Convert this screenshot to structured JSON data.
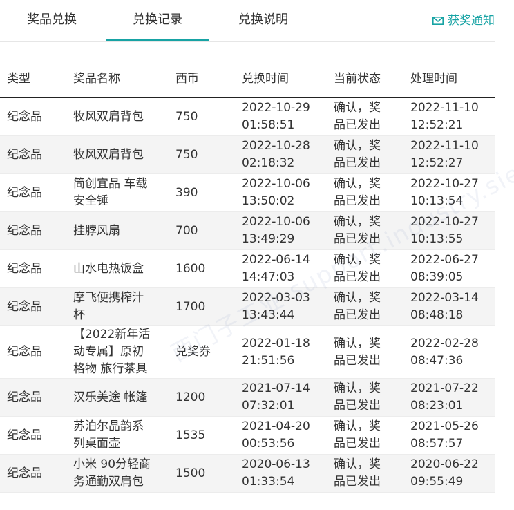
{
  "tabs": [
    {
      "label": "奖品兑换"
    },
    {
      "label": "兑换记录"
    },
    {
      "label": "兑换说明"
    }
  ],
  "notify": {
    "label": "获奖通知",
    "icon": "mail-icon"
  },
  "accent": "#17a3a4",
  "table": {
    "headers": [
      "类型",
      "奖品名称",
      "西币",
      "兑换时间",
      "当前状态",
      "处理时间"
    ],
    "rows": [
      {
        "type": "纪念品",
        "name": [
          "牧风双肩背包"
        ],
        "coin": "750",
        "time": [
          "2022-10-29",
          "01:58:51"
        ],
        "status": [
          "确认，奖",
          "品已发出"
        ],
        "proc": [
          "2022-11-10",
          "12:52:21"
        ]
      },
      {
        "type": "纪念品",
        "name": [
          "牧风双肩背包"
        ],
        "coin": "750",
        "time": [
          "2022-10-28",
          "02:18:32"
        ],
        "status": [
          "确认，奖",
          "品已发出"
        ],
        "proc": [
          "2022-11-10",
          "12:52:27"
        ]
      },
      {
        "type": "纪念品",
        "name": [
          "简创宜品 车载",
          "安全锤"
        ],
        "coin": "390",
        "time": [
          "2022-10-06",
          "13:50:02"
        ],
        "status": [
          "确认，奖",
          "品已发出"
        ],
        "proc": [
          "2022-10-27",
          "10:13:54"
        ]
      },
      {
        "type": "纪念品",
        "name": [
          "挂脖风扇"
        ],
        "coin": "700",
        "time": [
          "2022-10-06",
          "13:49:29"
        ],
        "status": [
          "确认，奖",
          "品已发出"
        ],
        "proc": [
          "2022-10-27",
          "10:13:55"
        ]
      },
      {
        "type": "纪念品",
        "name": [
          "山水电热饭盒"
        ],
        "coin": "1600",
        "time": [
          "2022-06-14",
          "14:47:03"
        ],
        "status": [
          "确认，奖",
          "品已发出"
        ],
        "proc": [
          "2022-06-27",
          "08:39:05"
        ]
      },
      {
        "type": "纪念品",
        "name": [
          "摩飞便携榨汁",
          "杯"
        ],
        "coin": "1700",
        "time": [
          "2022-03-03",
          "13:43:44"
        ],
        "status": [
          "确认，奖",
          "品已发出"
        ],
        "proc": [
          "2022-03-14",
          "08:48:18"
        ]
      },
      {
        "type": "纪念品",
        "name": [
          "【2022新年活",
          "动专属】原初",
          "格物 旅行茶具"
        ],
        "coin": "兑奖券",
        "time": [
          "2022-01-18",
          "21:51:56"
        ],
        "status": [
          "确认，奖",
          "品已发出"
        ],
        "proc": [
          "2022-02-28",
          "08:47:36"
        ]
      },
      {
        "type": "纪念品",
        "name": [
          "汉乐美途 帐篷"
        ],
        "coin": "1200",
        "time": [
          "2021-07-14",
          "07:32:01"
        ],
        "status": [
          "确认，奖",
          "品已发出"
        ],
        "proc": [
          "2021-07-22",
          "08:23:01"
        ]
      },
      {
        "type": "纪念品",
        "name": [
          "苏泊尔晶韵系",
          "列桌面壶"
        ],
        "coin": "1535",
        "time": [
          "2021-04-20",
          "00:53:56"
        ],
        "status": [
          "确认，奖",
          "品已发出"
        ],
        "proc": [
          "2021-05-26",
          "08:57:57"
        ]
      },
      {
        "type": "纪念品",
        "name": [
          "小米 90分轻商",
          "务通勤双肩包"
        ],
        "coin": "1500",
        "time": [
          "2020-06-13",
          "01:33:54"
        ],
        "status": [
          "确认，奖",
          "品已发出"
        ],
        "proc": [
          "2020-06-22",
          "09:55:49"
        ]
      }
    ]
  }
}
